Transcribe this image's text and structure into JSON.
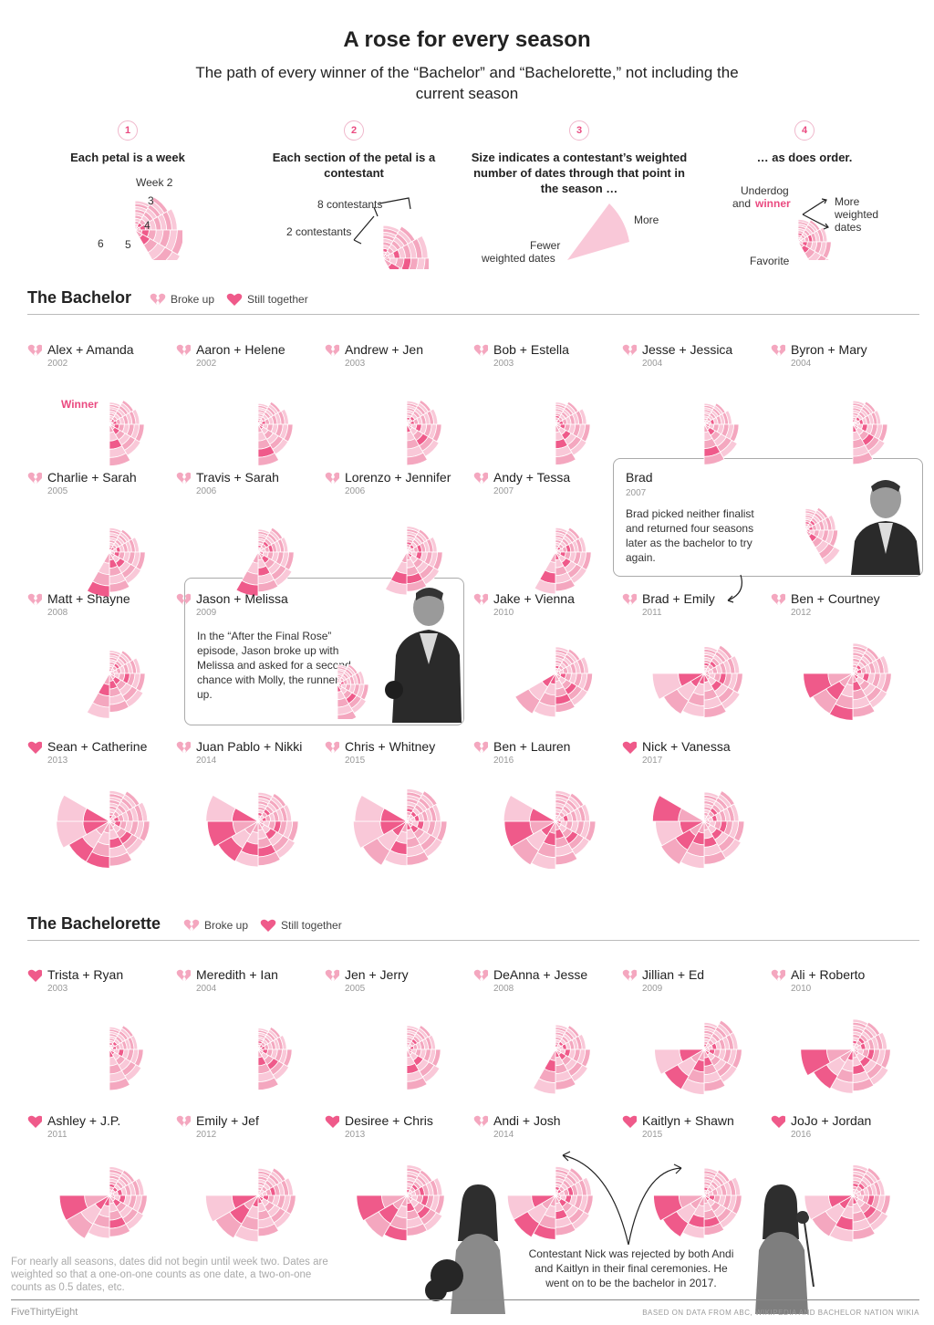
{
  "title": "A rose for every season",
  "subtitle": "The path of every winner of the “Bachelor” and “Bachelorette,” not including the current season",
  "legend": {
    "broke_up": "Broke up",
    "still_together": "Still together"
  },
  "explainer": [
    {
      "num": "1",
      "head": "Each petal is a week",
      "labels": [
        "Week 2",
        "3",
        "4",
        "5",
        "6"
      ]
    },
    {
      "num": "2",
      "head": "Each section of the petal is a contestant",
      "labels": [
        "8 contestants",
        "2 contestants"
      ]
    },
    {
      "num": "3",
      "head": "Size indicates a contestant’s weighted number of dates through that point in the season …",
      "labels": [
        "More",
        "Fewer",
        "weighted dates"
      ]
    },
    {
      "num": "4",
      "head": "… as does order.",
      "labels": [
        "Underdog",
        "and",
        "winner",
        "More",
        "weighted",
        "dates",
        "Favorite"
      ]
    }
  ],
  "winner_label": "Winner",
  "sections": [
    {
      "title": "The Bachelor"
    },
    {
      "title": "The Bachelorette"
    }
  ],
  "chart_data": {
    "type": "polar area (rose) small multiples",
    "encoding": "each petal is a week; each ring section of a petal is a contestant; dark pink section is the eventual winner",
    "bachelor": [
      {
        "name": "Alex + Amanda",
        "year": "2002",
        "status": "broke_up",
        "weeks": 6
      },
      {
        "name": "Aaron + Helene",
        "year": "2002",
        "status": "broke_up",
        "weeks": 6
      },
      {
        "name": "Andrew + Jen",
        "year": "2003",
        "status": "broke_up",
        "weeks": 6
      },
      {
        "name": "Bob + Estella",
        "year": "2003",
        "status": "broke_up",
        "weeks": 6
      },
      {
        "name": "Jesse + Jessica",
        "year": "2004",
        "status": "broke_up",
        "weeks": 6
      },
      {
        "name": "Byron + Mary",
        "year": "2004",
        "status": "broke_up",
        "weeks": 6
      },
      {
        "name": "Charlie + Sarah",
        "year": "2005",
        "status": "broke_up",
        "weeks": 7
      },
      {
        "name": "Travis + Sarah",
        "year": "2006",
        "status": "broke_up",
        "weeks": 7
      },
      {
        "name": "Lorenzo + Jennifer",
        "year": "2006",
        "status": "broke_up",
        "weeks": 7
      },
      {
        "name": "Andy + Tessa",
        "year": "2007",
        "status": "broke_up",
        "weeks": 7
      },
      {
        "name": "Matt + Shayne",
        "year": "2008",
        "status": "broke_up",
        "weeks": 7
      },
      {
        "name": "Jason + Melissa",
        "year": "2009",
        "status": "broke_up",
        "weeks": 8
      },
      {
        "name": "Jake + Vienna",
        "year": "2010",
        "status": "broke_up",
        "weeks": 8
      },
      {
        "name": "Brad + Emily",
        "year": "2011",
        "status": "broke_up",
        "weeks": 9
      },
      {
        "name": "Ben + Courtney",
        "year": "2012",
        "status": "broke_up",
        "weeks": 9
      },
      {
        "name": "Sean + Catherine",
        "year": "2013",
        "status": "together",
        "weeks": 10
      },
      {
        "name": "Juan Pablo + Nikki",
        "year": "2014",
        "status": "broke_up",
        "weeks": 10
      },
      {
        "name": "Chris + Whitney",
        "year": "2015",
        "status": "broke_up",
        "weeks": 10
      },
      {
        "name": "Ben + Lauren",
        "year": "2016",
        "status": "broke_up",
        "weeks": 10
      },
      {
        "name": "Nick + Vanessa",
        "year": "2017",
        "status": "together",
        "weeks": 10
      }
    ],
    "bachelorette": [
      {
        "name": "Trista + Ryan",
        "year": "2003",
        "status": "together",
        "weeks": 6
      },
      {
        "name": "Meredith + Ian",
        "year": "2004",
        "status": "broke_up",
        "weeks": 6
      },
      {
        "name": "Jen + Jerry",
        "year": "2005",
        "status": "broke_up",
        "weeks": 6
      },
      {
        "name": "DeAnna + Jesse",
        "year": "2008",
        "status": "broke_up",
        "weeks": 7
      },
      {
        "name": "Jillian + Ed",
        "year": "2009",
        "status": "broke_up",
        "weeks": 9
      },
      {
        "name": "Ali + Roberto",
        "year": "2010",
        "status": "broke_up",
        "weeks": 9
      },
      {
        "name": "Ashley + J.P.",
        "year": "2011",
        "status": "together",
        "weeks": 9
      },
      {
        "name": "Emily + Jef",
        "year": "2012",
        "status": "broke_up",
        "weeks": 9
      },
      {
        "name": "Desiree + Chris",
        "year": "2013",
        "status": "together",
        "weeks": 9
      },
      {
        "name": "Andi + Josh",
        "year": "2014",
        "status": "broke_up",
        "weeks": 9
      },
      {
        "name": "Kaitlyn + Shawn",
        "year": "2015",
        "status": "together",
        "weeks": 9
      },
      {
        "name": "JoJo + Jordan",
        "year": "2016",
        "status": "together",
        "weeks": 9
      }
    ]
  },
  "callouts": {
    "brad": {
      "name": "Brad",
      "year": "2007",
      "text": "Brad picked neither finalist and returned four seasons later as the bachelor to try again."
    },
    "jason": {
      "name": "Jason + Melissa",
      "year": "2009",
      "text": "In the “After the Final Rose” episode, Jason broke up with Melissa and asked for a second chance with Molly, the runner-up."
    },
    "nick": {
      "text": "Contestant Nick was rejected by both Andi and Kaitlyn in their final ceremonies. He went on to be the bachelor in 2017."
    }
  },
  "footnote": "For nearly all seasons, dates did not begin until week two. Dates are weighted so that a one-on-one counts as one date, a two-on-one counts as 0.5 dates, etc.",
  "credit_left": "FiveThirtyEight",
  "credit_right": "BASED ON DATA FROM ABC, WIKIPEDIA AND BACHELOR NATION WIKIA",
  "colors": {
    "light": "#f9c8d8",
    "mid": "#f4a7bf",
    "winner": "#ef5a8a",
    "line": "#ffffff"
  }
}
